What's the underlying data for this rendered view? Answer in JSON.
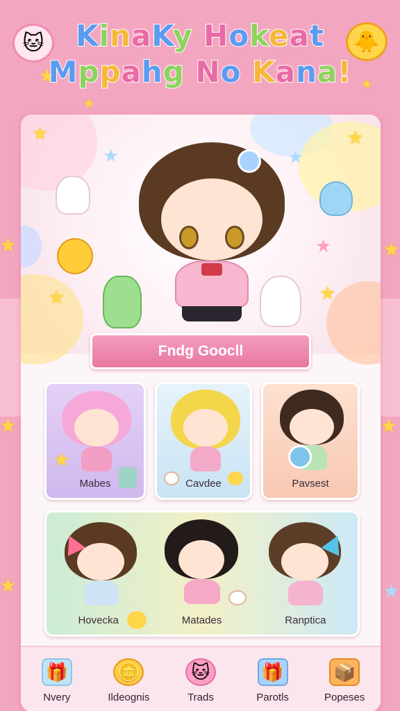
{
  "header": {
    "title_line1": "KinaKy Hokeat",
    "title_line2": "Mppahg No Kana!"
  },
  "hero": {
    "banner_label": "Fndg Goocll"
  },
  "characters": [
    {
      "label": "Mabes",
      "bg": "#d9c8f0"
    },
    {
      "label": "Cavdee",
      "bg": "#d7ecf7"
    },
    {
      "label": "Pavsest",
      "bg": "#fbd8c6"
    }
  ],
  "group": {
    "items": [
      {
        "label": "Hovecka"
      },
      {
        "label": "Matades"
      },
      {
        "label": "Ranptica"
      }
    ]
  },
  "nav": {
    "items": [
      {
        "label": "Nvery",
        "icon": "gift-box-icon"
      },
      {
        "label": "Ildeognis",
        "icon": "coin-stack-icon"
      },
      {
        "label": "Trads",
        "icon": "pink-cat-icon"
      },
      {
        "label": "Parotls",
        "icon": "present-icon"
      },
      {
        "label": "Popeses",
        "icon": "package-icon"
      }
    ]
  },
  "colors": {
    "background": "#f3a6c0",
    "banner": "#e8779f",
    "card": "#fdf6f8"
  }
}
